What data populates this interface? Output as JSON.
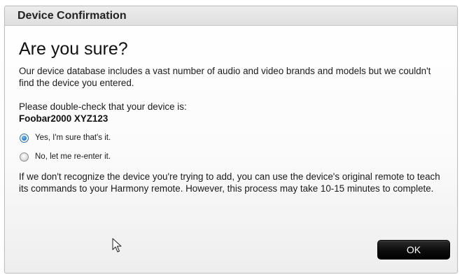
{
  "dialog": {
    "title": "Device Confirmation",
    "heading": "Are you sure?",
    "intro": "Our device database includes a vast number of audio and video brands and models but we couldn't find the device you entered.",
    "check_label": "Please double-check that your device is:",
    "device_name": "Foobar2000 XYZ123",
    "options": [
      {
        "label": "Yes, I'm sure that's it.",
        "selected": true
      },
      {
        "label": "No, let me re-enter it.",
        "selected": false
      }
    ],
    "explanation": "If we don't recognize the device you're trying to add, you can use the device's original remote to teach its commands to your Harmony remote. However, this process may take 10-15 minutes to complete.",
    "ok_label": "OK"
  },
  "colors": {
    "radio_selected": "#2a7fc9",
    "ok_button": "#0c0c0c",
    "titlebar": "#e4e4e4"
  },
  "icons": {
    "cursor": "mouse-pointer-icon"
  }
}
